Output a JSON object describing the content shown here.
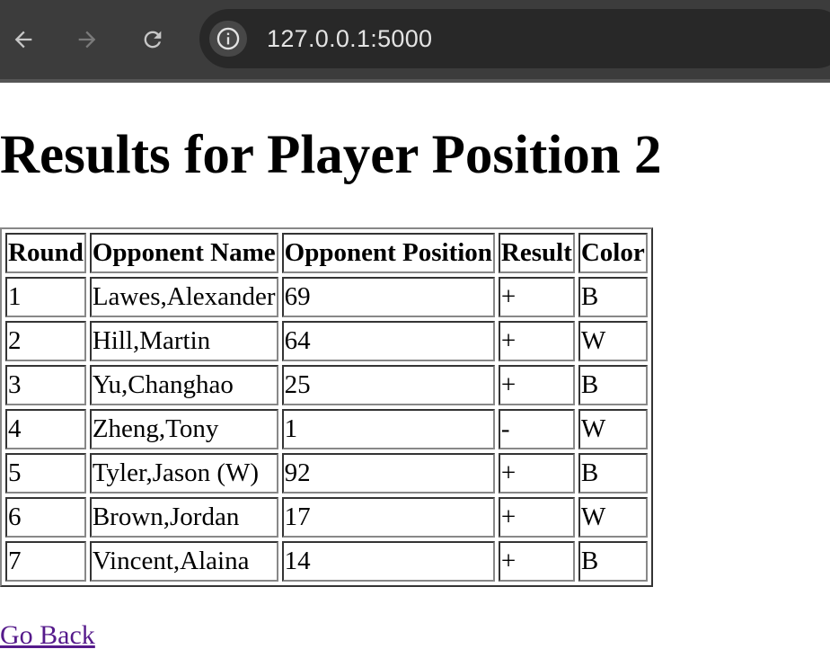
{
  "browser": {
    "url": "127.0.0.1:5000",
    "back_icon": "arrow-left-icon",
    "forward_icon": "arrow-right-icon",
    "reload_icon": "reload-icon",
    "site_info_icon": "info-icon"
  },
  "page": {
    "title": "Results for Player Position 2",
    "table": {
      "headers": [
        "Round",
        "Opponent Name",
        "Opponent Position",
        "Result",
        "Color"
      ],
      "rows": [
        [
          "1",
          "Lawes,Alexander",
          "69",
          "+",
          "B"
        ],
        [
          "2",
          "Hill,Martin",
          "64",
          "+",
          "W"
        ],
        [
          "3",
          "Yu,Changhao",
          "25",
          "+",
          "B"
        ],
        [
          "4",
          "Zheng,Tony",
          "1",
          "-",
          "W"
        ],
        [
          "5",
          "Tyler,Jason (W)",
          "92",
          "+",
          "B"
        ],
        [
          "6",
          "Brown,Jordan",
          "17",
          "+",
          "W"
        ],
        [
          "7",
          "Vincent,Alaina",
          "14",
          "+",
          "B"
        ]
      ]
    },
    "back_link": "Go Back"
  }
}
